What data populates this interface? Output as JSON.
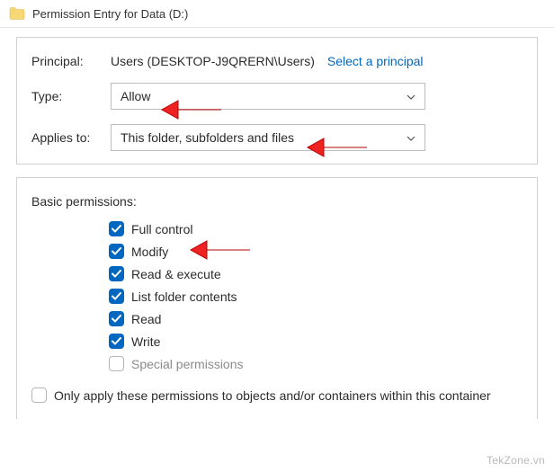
{
  "titlebar": {
    "title": "Permission Entry for Data (D:)"
  },
  "principal": {
    "label": "Principal:",
    "value": "Users (DESKTOP-J9QRERN\\Users)",
    "link": "Select a principal"
  },
  "type": {
    "label": "Type:",
    "value": "Allow"
  },
  "applies": {
    "label": "Applies to:",
    "value": "This folder, subfolders and files"
  },
  "permsTitle": "Basic permissions:",
  "perms": {
    "full": "Full control",
    "modify": "Modify",
    "readexec": "Read & execute",
    "listfolder": "List folder contents",
    "read": "Read",
    "write": "Write",
    "special": "Special permissions"
  },
  "onlyApply": "Only apply these permissions to objects and/or containers within this container",
  "watermark": "TekZone.vn"
}
